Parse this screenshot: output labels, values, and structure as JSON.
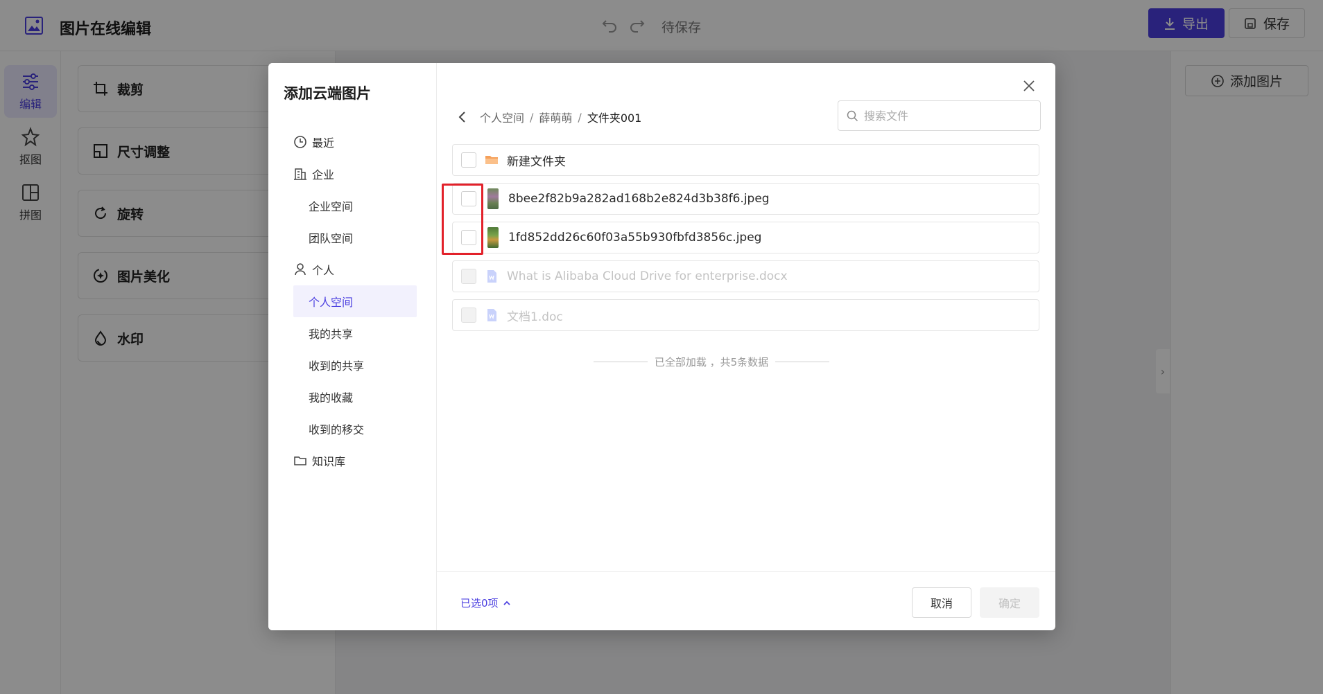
{
  "app": {
    "title": "图片在线编辑",
    "save_state": "待保存",
    "export_label": "导出",
    "save_label": "保存"
  },
  "left_rail": [
    {
      "label": "编辑",
      "icon": "sliders-icon",
      "active": true
    },
    {
      "label": "抠图",
      "icon": "magic-wand-icon",
      "active": false
    },
    {
      "label": "拼图",
      "icon": "layout-grid-icon",
      "active": false
    }
  ],
  "tools": [
    {
      "label": "裁剪",
      "icon": "crop-icon"
    },
    {
      "label": "尺寸调整",
      "icon": "resize-icon"
    },
    {
      "label": "旋转",
      "icon": "rotate-icon"
    },
    {
      "label": "图片美化",
      "icon": "beautify-icon"
    },
    {
      "label": "水印",
      "icon": "watermark-icon"
    }
  ],
  "right_panel": {
    "add_image_label": "添加图片"
  },
  "modal": {
    "title": "添加云端图片",
    "nav": [
      {
        "label": "最近",
        "icon": "clock-icon",
        "level": 0
      },
      {
        "label": "企业",
        "icon": "building-icon",
        "level": 0
      },
      {
        "label": "企业空间",
        "level": 1
      },
      {
        "label": "团队空间",
        "level": 1
      },
      {
        "label": "个人",
        "icon": "user-icon",
        "level": 0
      },
      {
        "label": "个人空间",
        "level": 1,
        "active": true
      },
      {
        "label": "我的共享",
        "level": 1
      },
      {
        "label": "收到的共享",
        "level": 1
      },
      {
        "label": "我的收藏",
        "level": 1
      },
      {
        "label": "收到的移交",
        "level": 1
      },
      {
        "label": "知识库",
        "icon": "folder-icon",
        "level": 0
      }
    ],
    "breadcrumb": [
      "个人空间",
      "薛萌萌",
      "文件夹001"
    ],
    "search_placeholder": "搜索文件",
    "files": [
      {
        "name": "新建文件夹",
        "type": "folder",
        "enabled": true
      },
      {
        "name": "8bee2f82b9a282ad168b2e824d3b38f6.jpeg",
        "type": "image",
        "enabled": true
      },
      {
        "name": "1fd852dd26c60f03a55b930fbfd3856c.jpeg",
        "type": "image",
        "enabled": true
      },
      {
        "name": "What is Alibaba Cloud Drive for enterprise.docx",
        "type": "document",
        "enabled": false
      },
      {
        "name": "文档1.doc",
        "type": "document",
        "enabled": false
      }
    ],
    "end_note": "已全部加载 ，共5条数据",
    "selected_label": "已选0项",
    "cancel_label": "取消",
    "confirm_label": "确定"
  },
  "colors": {
    "accent": "#4b3fe0",
    "highlight": "#e2212a",
    "folder": "#f5a05a",
    "doc": "#8a9cf0"
  }
}
